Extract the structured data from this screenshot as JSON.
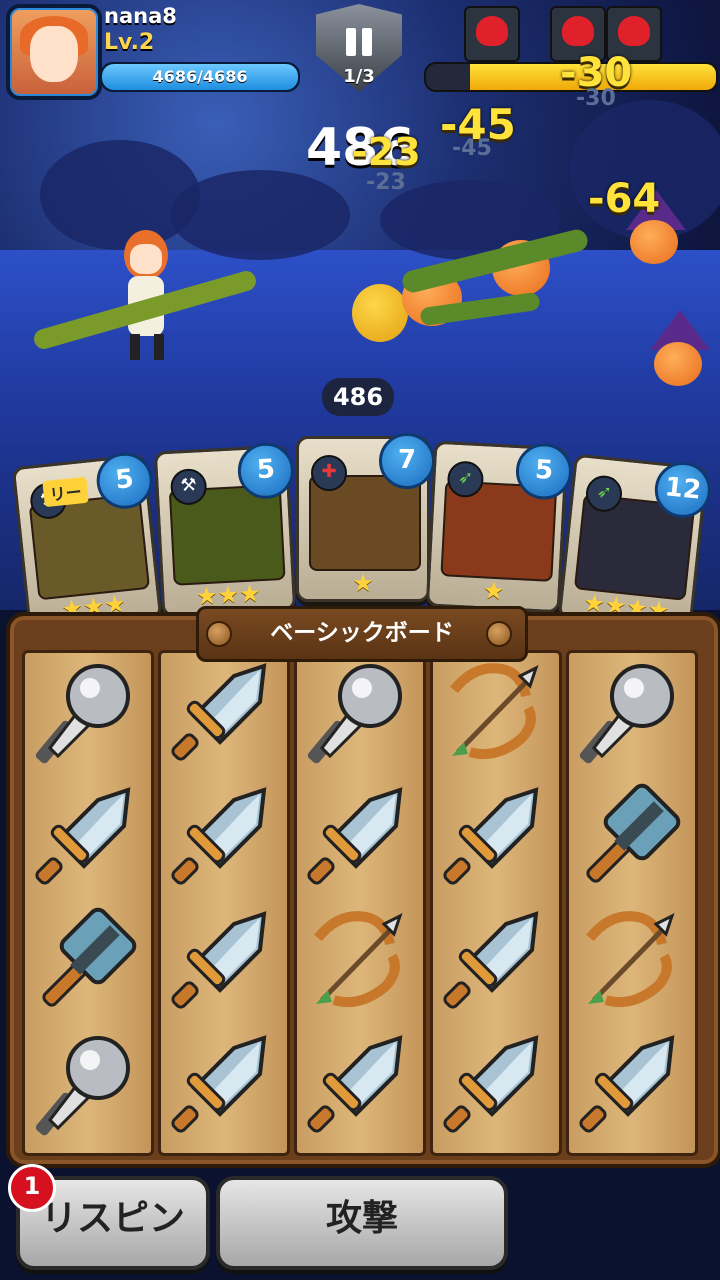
{
  "player": {
    "name": "nana8",
    "level": "Lv.2",
    "hp_text": "4686/4686",
    "hp_fraction": 1.0
  },
  "wave": {
    "text": "1/3"
  },
  "enemy": {
    "hp_fraction": 0.85,
    "skull_count": 3
  },
  "battle": {
    "score": "486",
    "damage_numbers": [
      "-23",
      "-45",
      "-30",
      "-64"
    ],
    "ghost_numbers": [
      "-23",
      "-45",
      "-30"
    ],
    "combo": "486"
  },
  "cards": [
    {
      "level": "5",
      "type_icon": "hammer-icon",
      "stars": "★★★",
      "leader_label": "リー"
    },
    {
      "level": "5",
      "type_icon": "hammer-icon",
      "stars": "★★★"
    },
    {
      "level": "7",
      "type_icon": "mace-icon",
      "stars": "★"
    },
    {
      "level": "5",
      "type_icon": "bow-icon",
      "stars": "★"
    },
    {
      "level": "12",
      "type_icon": "bow-icon",
      "stars": "★★★★"
    }
  ],
  "board": {
    "title": "ベーシックボード",
    "columns": [
      [
        "mace",
        "sword",
        "hammer",
        "mace"
      ],
      [
        "sword",
        "sword",
        "sword",
        "sword"
      ],
      [
        "mace",
        "sword",
        "bow",
        "sword"
      ],
      [
        "bow",
        "sword",
        "sword",
        "sword"
      ],
      [
        "mace",
        "hammer",
        "bow",
        "sword"
      ]
    ]
  },
  "buttons": {
    "respin_label": "リスピン",
    "respin_badge": "1",
    "attack_label": "攻撃"
  },
  "colors": {
    "hp": "#1e8ee0",
    "enemy_hp": "#ffe23a",
    "board": "#6b3f1c",
    "badge": "#1c6cc0"
  }
}
